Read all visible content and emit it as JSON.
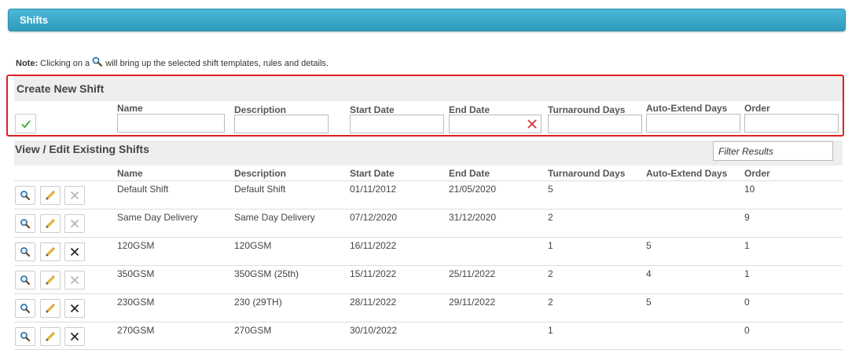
{
  "header": {
    "title": "Shifts"
  },
  "note": {
    "label": "Note:",
    "before_icon": "Clicking on a",
    "after_icon": "will bring up the selected shift templates, rules and details.",
    "icon": "magnifier-icon"
  },
  "create": {
    "title": "Create New Shift",
    "columns": [
      "Name",
      "Description",
      "Start Date",
      "End Date",
      "Turnaround Days",
      "Auto-Extend Days",
      "Order"
    ],
    "values": {
      "name": "",
      "description": "",
      "start_date": "",
      "end_date": "",
      "turnaround_days": "",
      "auto_extend_days": "",
      "order": ""
    },
    "submit_icon": "checkmark-icon",
    "clear_icon": "clear-x-icon"
  },
  "existing": {
    "title": "View / Edit Existing Shifts",
    "filter_placeholder": "Filter Results",
    "columns": [
      "Name",
      "Description",
      "Start Date",
      "End Date",
      "Turnaround Days",
      "Auto-Extend Days",
      "Order"
    ],
    "rows": [
      {
        "name": "Default Shift",
        "description": "Default Shift",
        "start": "01/11/2012",
        "end": "21/05/2020",
        "turnaround": "5",
        "autoextend": "",
        "order": "10",
        "delete_enabled": false
      },
      {
        "name": "Same Day Delivery",
        "description": "Same Day Delivery",
        "start": "07/12/2020",
        "end": "31/12/2020",
        "turnaround": "2",
        "autoextend": "",
        "order": "9",
        "delete_enabled": false
      },
      {
        "name": "120GSM",
        "description": "120GSM",
        "start": "16/11/2022",
        "end": "",
        "turnaround": "1",
        "autoextend": "5",
        "order": "1",
        "delete_enabled": true
      },
      {
        "name": "350GSM",
        "description": "350GSM (25th)",
        "start": "15/11/2022",
        "end": "25/11/2022",
        "turnaround": "2",
        "autoextend": "4",
        "order": "1",
        "delete_enabled": false
      },
      {
        "name": "230GSM",
        "description": "230 (29TH)",
        "start": "28/11/2022",
        "end": "29/11/2022",
        "turnaround": "2",
        "autoextend": "5",
        "order": "0",
        "delete_enabled": true
      },
      {
        "name": "270GSM",
        "description": "270GSM",
        "start": "30/10/2022",
        "end": "",
        "turnaround": "1",
        "autoextend": "",
        "order": "0",
        "delete_enabled": true
      }
    ]
  },
  "colors": {
    "header_top": "#4cb8d6",
    "header_bottom": "#2e9bbd",
    "highlight": "#e02020",
    "check": "#3aaa35",
    "clear_x": "#e03030"
  }
}
